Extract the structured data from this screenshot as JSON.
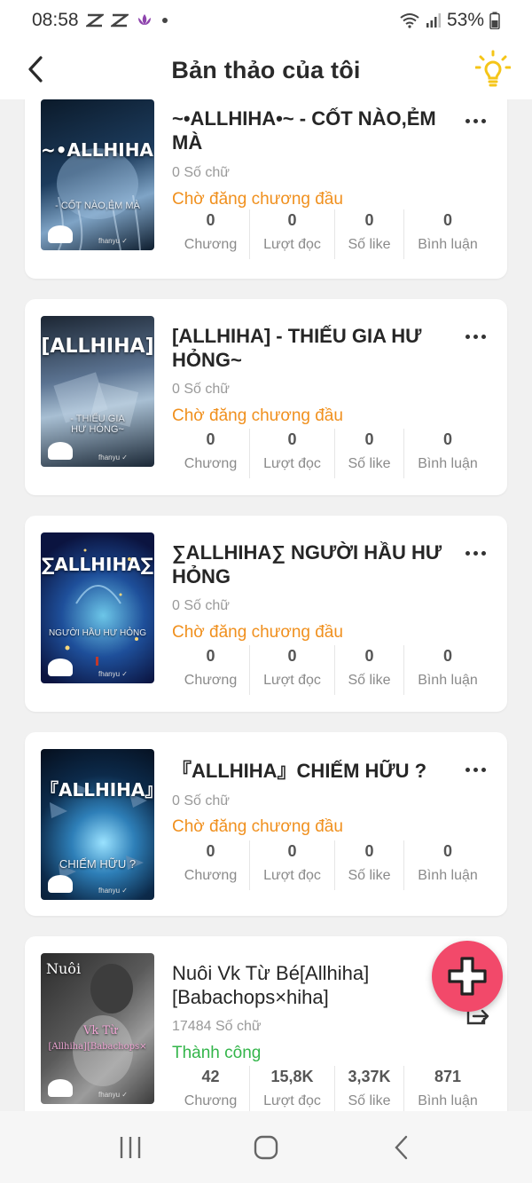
{
  "status_bar": {
    "time": "08:58",
    "battery": "53%",
    "icons": [
      "notification-icon",
      "notification-icon",
      "lotus-icon",
      "dot-icon",
      "wifi-icon",
      "signal-icon",
      "battery-icon"
    ]
  },
  "header": {
    "title": "Bản thảo của tôi",
    "back_icon": "chevron-left-icon",
    "tip_icon": "lightbulb-icon",
    "accent": "#f5c518"
  },
  "stat_labels": [
    "Chương",
    "Lượt đọc",
    "Số like",
    "Bình luận"
  ],
  "stories": [
    {
      "title": "~•ALLHIHA•~ - CỐT NÀO,ẺM MÀ",
      "words": "0 Số chữ",
      "status": "Chờ đăng chương đầu",
      "cover_title": "~•ALLHIHA•~",
      "cover_sub": "- CỐT NÀO,ẺM MÀ",
      "cover_author": "fhanyu ✓",
      "stats": [
        "0",
        "0",
        "0",
        "0"
      ]
    },
    {
      "title": "[ALLHIHA] - THIẾU GIA HƯ HỎNG~",
      "words": "0 Số chữ",
      "status": "Chờ đăng chương đầu",
      "cover_title": "[ALLHIHA]",
      "cover_sub": "- THIẾU GIA HƯ HỎNG~",
      "cover_author": "fhanyu ✓",
      "stats": [
        "0",
        "0",
        "0",
        "0"
      ]
    },
    {
      "title": "∑ALLHIHA∑ NGƯỜI HẦU HƯ HỎNG",
      "words": "0 Số chữ",
      "status": "Chờ đăng chương đầu",
      "cover_title": "∑ALLHIHA∑",
      "cover_sub": "NGƯỜI HẦU HƯ HỎNG",
      "cover_author": "fhanyu ✓",
      "stats": [
        "0",
        "0",
        "0",
        "0"
      ]
    },
    {
      "title": "『ALLHIHA』CHIẾM HỮU ?",
      "words": "0 Số chữ",
      "status": "Chờ đăng chương đầu",
      "cover_title": "『ALLHIHA』",
      "cover_sub": "CHIẾM HỮU ?",
      "cover_author": "fhanyu ✓",
      "stats": [
        "0",
        "0",
        "0",
        "0"
      ]
    },
    {
      "title": "Nuôi Vk Từ Bé[Allhiha][Babachops×hiha]",
      "words": "17484 Số chữ",
      "status": "Thành công",
      "cover_title": "Nuôi",
      "cover_sub": "Vk Từ",
      "cover_sub2": "[Allhiha][Babachops×",
      "cover_author": "fhanyu ✓",
      "stats": [
        "42",
        "15,8K",
        "3,37K",
        "871"
      ]
    }
  ],
  "fab": {
    "icon": "plus-icon",
    "color": "#f2496a"
  },
  "nav": {
    "icons": [
      "recent-apps-icon",
      "home-icon",
      "back-icon"
    ]
  }
}
